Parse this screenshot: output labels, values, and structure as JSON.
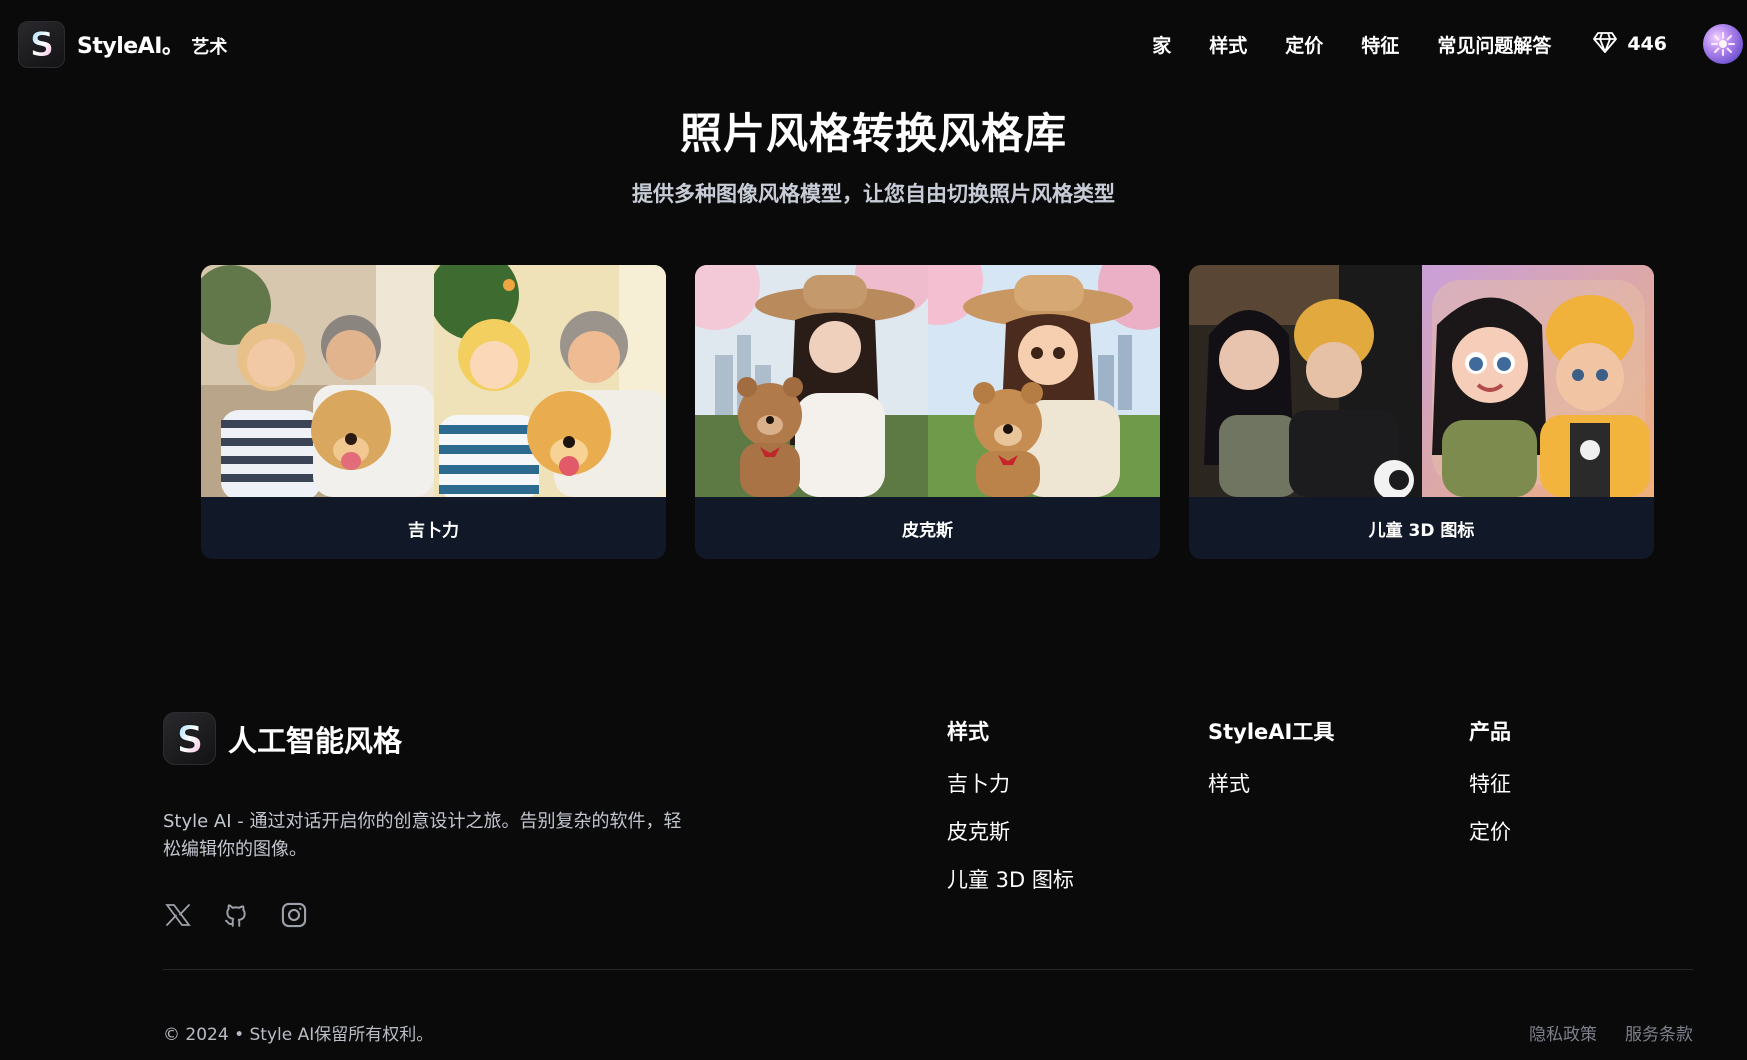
{
  "header": {
    "brand_name": "StyleAI。",
    "brand_suffix": "艺术",
    "nav": [
      "家",
      "样式",
      "定价",
      "特征",
      "常见问题解答"
    ],
    "credits": "446"
  },
  "hero": {
    "title": "照片风格转换风格库",
    "subtitle": "提供多种图像风格模型，让您自由切换照片风格类型"
  },
  "cards": [
    {
      "label": "吉卜力"
    },
    {
      "label": "皮克斯"
    },
    {
      "label": "儿童 3D 图标"
    }
  ],
  "footer": {
    "brand_name": "人工智能风格",
    "description": "Style AI - 通过对话开启你的创意设计之旅。告别复杂的软件，轻松编辑你的图像。",
    "columns": [
      {
        "title": "样式",
        "items": [
          "吉卜力",
          "皮克斯",
          "儿童 3D 图标"
        ]
      },
      {
        "title": "StyleAI工具",
        "items": [
          "样式"
        ]
      },
      {
        "title": "产品",
        "items": [
          "特征",
          "定价"
        ]
      }
    ],
    "copyright": "© 2024 • Style AI保留所有权利。",
    "legal": [
      "隐私政策",
      "服务条款"
    ]
  },
  "colors": {
    "background": "#0a0a0b",
    "card_label_bg": "#111827",
    "muted_text": "#7b7f88"
  },
  "icons": [
    "logo-s-icon",
    "diamond-icon",
    "x-twitter-icon",
    "github-icon",
    "instagram-icon"
  ]
}
